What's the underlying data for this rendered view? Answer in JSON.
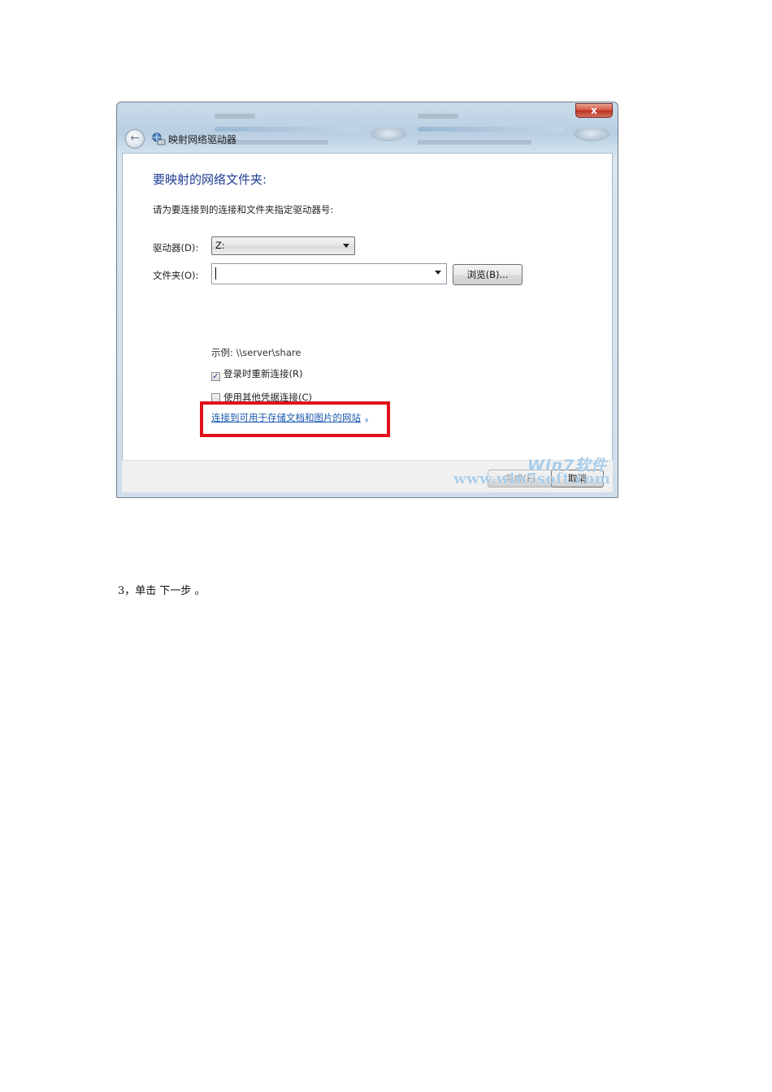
{
  "window": {
    "title": "映射网络驱动器",
    "close_glyph": "x",
    "back_glyph": "←"
  },
  "dialog": {
    "heading": "要映射的网络文件夹:",
    "instruction": "请为要连接到的连接和文件夹指定驱动器号:",
    "drive": {
      "label": "驱动器(D):",
      "value": "Z:"
    },
    "folder": {
      "label": "文件夹(O):",
      "value": ""
    },
    "browse_label": "浏览(B)...",
    "example": "示例: \\\\server\\share",
    "reconnect": {
      "label": "登录时重新连接(R)",
      "checked": true,
      "check_glyph": "✓"
    },
    "other_credentials": {
      "label": "使用其他凭据连接(C)",
      "checked": false
    },
    "link_text": "连接到可用于存储文档和图片的网站",
    "link_suffix": "。",
    "finish_label": "完成(F)",
    "cancel_label": "取消"
  },
  "watermark": {
    "logo": "Win7软件",
    "url": "www.win7soft.com"
  },
  "annotation": {
    "highlight_color": "#e0101c"
  },
  "step_text": "3，单击 下一步 。"
}
